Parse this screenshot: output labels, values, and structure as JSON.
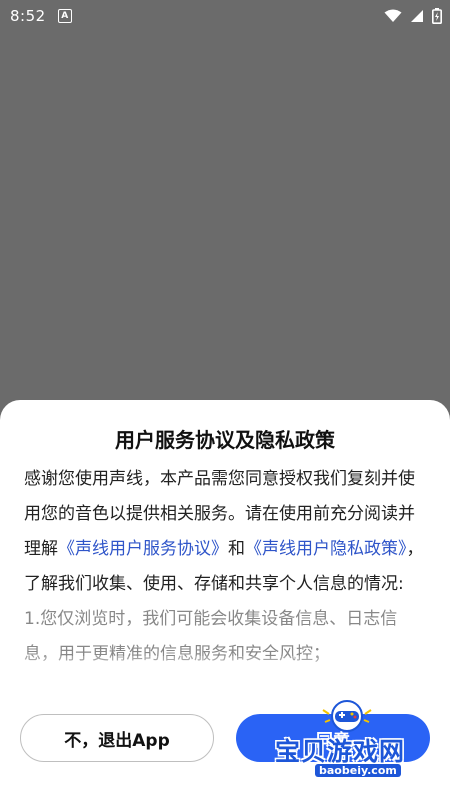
{
  "status_bar": {
    "time": "8:52",
    "indicator": "A",
    "icons": [
      "wifi-icon",
      "signal-icon",
      "battery-icon"
    ]
  },
  "dialog": {
    "title": "用户服务协议及隐私政策",
    "body_intro": "感谢您使用声线，本产品需您同意授权我们复刻并使用您的音色以提供相关服务。请在使用前充分阅读并理解",
    "link_service": "《声线用户服务协议》",
    "conj": "和",
    "link_privacy": "《声线用户隐私政策》",
    "body_outro": "，了解我们收集、使用、存储和共享个人信息的情况:",
    "item_1": "1.您仅浏览时，我们可能会收集设备信息、日志信息，用于更精准的信息服务和安全风控；",
    "exit_label": "不，退出App",
    "agree_label": "同意"
  },
  "watermark": {
    "text": "宝贝游戏网",
    "url": "baobeiy.com"
  },
  "colors": {
    "link": "#2f55c9",
    "primary": "#2a63f5",
    "overlay": "#6b6b6b"
  }
}
